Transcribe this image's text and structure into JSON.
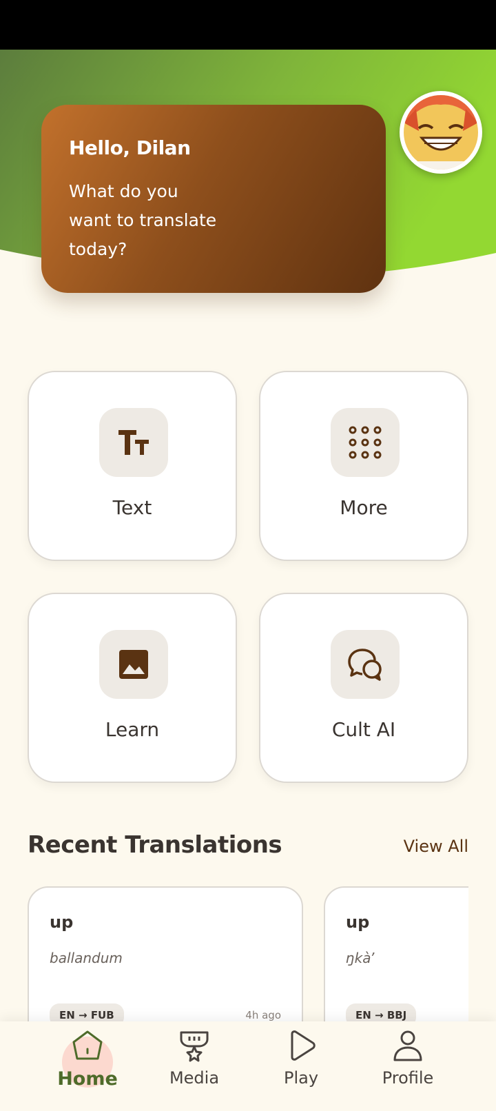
{
  "greeting": {
    "title": "Hello, Dilan",
    "subtitle": "What do you want to translate today?"
  },
  "tiles": [
    {
      "label": "Text",
      "icon": "text-size-icon"
    },
    {
      "label": "More",
      "icon": "grid-dots-icon"
    },
    {
      "label": "Learn",
      "icon": "image-icon"
    },
    {
      "label": "Cult AI",
      "icon": "chat-bubbles-icon"
    }
  ],
  "recent": {
    "title": "Recent Translations",
    "view_all": "View All",
    "items": [
      {
        "word": "up",
        "translation": "ballandum",
        "langs": "EN → FUB",
        "time": "4h ago"
      },
      {
        "word": "up",
        "translation": "ŋkàʼ",
        "langs": "EN → BBJ",
        "time": ""
      }
    ]
  },
  "nav": {
    "items": [
      {
        "label": "Home",
        "icon": "home-icon",
        "active": true
      },
      {
        "label": "Media",
        "icon": "media-icon",
        "active": false
      },
      {
        "label": "Play",
        "icon": "play-icon",
        "active": false
      },
      {
        "label": "Profile",
        "icon": "profile-icon",
        "active": false
      }
    ]
  },
  "colors": {
    "accent_brown": "#5f3210",
    "accent_green": "#8fd13a",
    "background": "#fdf9ee"
  }
}
